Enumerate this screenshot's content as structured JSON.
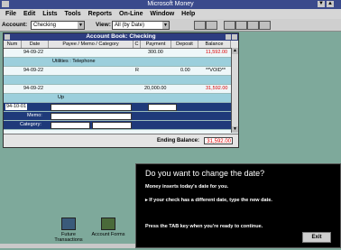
{
  "app": {
    "title": "Microsoft Money"
  },
  "menu": [
    "File",
    "Edit",
    "Lists",
    "Tools",
    "Reports",
    "On-Line",
    "Window",
    "Help"
  ],
  "toolbar": {
    "account_label": "Account:",
    "account_value": "Checking",
    "view_label": "View:",
    "view_value": "All (by Date)"
  },
  "register": {
    "title": "Account Book: Checking",
    "columns": [
      "Num",
      "Date",
      "Payee / Memo / Category",
      "C",
      "Payment",
      "Deposit",
      "Balance"
    ],
    "rows": [
      {
        "num": "",
        "date": "94-09-22",
        "payee": "",
        "c": "",
        "payment": "300.00",
        "deposit": "",
        "balance": "11,592.00"
      },
      {
        "num": "",
        "date": "",
        "payee": "Utilities : Telephone",
        "c": "",
        "payment": "",
        "deposit": "",
        "balance": ""
      },
      {
        "num": "",
        "date": "94-09-22",
        "payee": "",
        "c": "R",
        "payment": "",
        "deposit": "0.00",
        "balance": "**VOID**"
      },
      {
        "num": "",
        "date": "",
        "payee": "",
        "c": "",
        "payment": "",
        "deposit": "",
        "balance": ""
      },
      {
        "num": "",
        "date": "94-09-22",
        "payee": "",
        "c": "",
        "payment": "20,000.00",
        "deposit": "",
        "balance": "31,592.00"
      },
      {
        "num": "",
        "date": "",
        "payee": "",
        "c": "",
        "payment": "",
        "deposit": "",
        "balance": ""
      }
    ],
    "edit_row": {
      "date": "94-10-01",
      "memo_label": "Memo:",
      "category_label": "Category:",
      "hint": "Up"
    },
    "ending_label": "Ending Balance:",
    "ending_value": "31,592.00"
  },
  "desktop": [
    {
      "label": "Future Transactions",
      "icon": "calendar-icon"
    },
    {
      "label": "Account Forms",
      "icon": "forms-icon"
    }
  ],
  "help": {
    "question": "Do you want to change the date?",
    "line1": "Money inserts today's date for you.",
    "line2": "If your check has a different date, type the new date.",
    "line3": "Press the TAB key when you're ready to continue.",
    "exit": "Exit"
  }
}
